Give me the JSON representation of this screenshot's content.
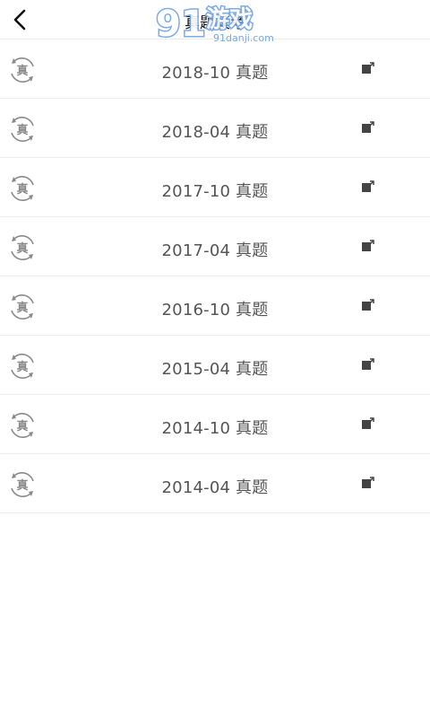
{
  "header": {
    "title": "真题模考",
    "back_icon": "chevron-left-icon"
  },
  "watermark": {
    "logo_text": "游戏",
    "logo_digits": "91",
    "site": "91danji.com"
  },
  "item_badge_glyph": "真",
  "items": [
    {
      "label": "2018-10 真题"
    },
    {
      "label": "2018-04 真题"
    },
    {
      "label": "2017-10 真题"
    },
    {
      "label": "2017-04 真题"
    },
    {
      "label": "2016-10 真题"
    },
    {
      "label": "2015-04 真题"
    },
    {
      "label": "2014-10 真题"
    },
    {
      "label": "2014-04 真题"
    }
  ],
  "colors": {
    "text": "#555555",
    "title": "#111111",
    "divider": "#ececec",
    "icon": "#8a8a8a",
    "watermark": "#6fa3e6"
  }
}
